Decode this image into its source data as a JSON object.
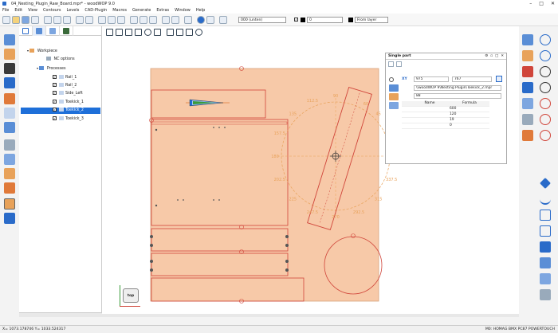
{
  "window": {
    "title": "04_Nesting_Plugin_Raw_Board.mpr* - woodWOP 9.0",
    "controls": [
      "–",
      "□",
      "✕"
    ]
  },
  "menu": [
    "File",
    "Edit",
    "View",
    "Contours",
    "Levels",
    "CAD-Plugin",
    "Macros",
    "Generate",
    "Extras",
    "Window",
    "Help"
  ],
  "toolbar": {
    "level_select": "000 (unten)",
    "color_select": "0",
    "layer_select": "From layer"
  },
  "tree": {
    "root": "Workpiece",
    "nc_options": "NC options",
    "processes": "Processes",
    "items": [
      "Rail_1",
      "Rail_2",
      "Side_Left",
      "Toekick_1",
      "Toekick_2",
      "Toekick_3"
    ],
    "selected_index": 4
  },
  "single_part": {
    "title": "Single part",
    "x_label": "XY",
    "x_value": "975",
    "y_value": "767",
    "path": "\\\\woodWOP 9\\Nesting Plugin\\Toekick_2.mpr",
    "field2": "88",
    "headers": [
      "Name",
      "Formula"
    ],
    "rows": [
      {
        "idx": "",
        "name": "",
        "formula": "600"
      },
      {
        "idx": "",
        "name": "",
        "formula": "120"
      },
      {
        "idx": "",
        "name": "",
        "formula": "19"
      },
      {
        "idx": "",
        "name": "",
        "formula": "0"
      }
    ]
  },
  "dial": {
    "labels": [
      "45",
      "67.5",
      "90",
      "112.5",
      "135",
      "157.5",
      "180",
      "202.5",
      "225",
      "247.5",
      "270",
      "292.5",
      "315",
      "337.5",
      "0",
      "22.5",
      "315",
      "325"
    ],
    "shown": [
      "45",
      "60",
      "90",
      "112.5",
      "135",
      "157.5",
      "180",
      "202.5",
      "225",
      "247.5",
      "270",
      "292.5",
      "315",
      "337.5",
      "0",
      "22.5"
    ]
  },
  "view_cube": {
    "label": "top"
  },
  "status": {
    "coords": "X= 1073.178746 Y= 1033.524317",
    "machine": "M0: HOMAG BMX PC87 POWERTOUCH"
  },
  "colors": {
    "board": "#f7c9a8",
    "board_stroke": "#d8a27c",
    "part_stroke": "#d0453a",
    "dial": "#e8a25a",
    "selected": "#1e6fd9"
  }
}
